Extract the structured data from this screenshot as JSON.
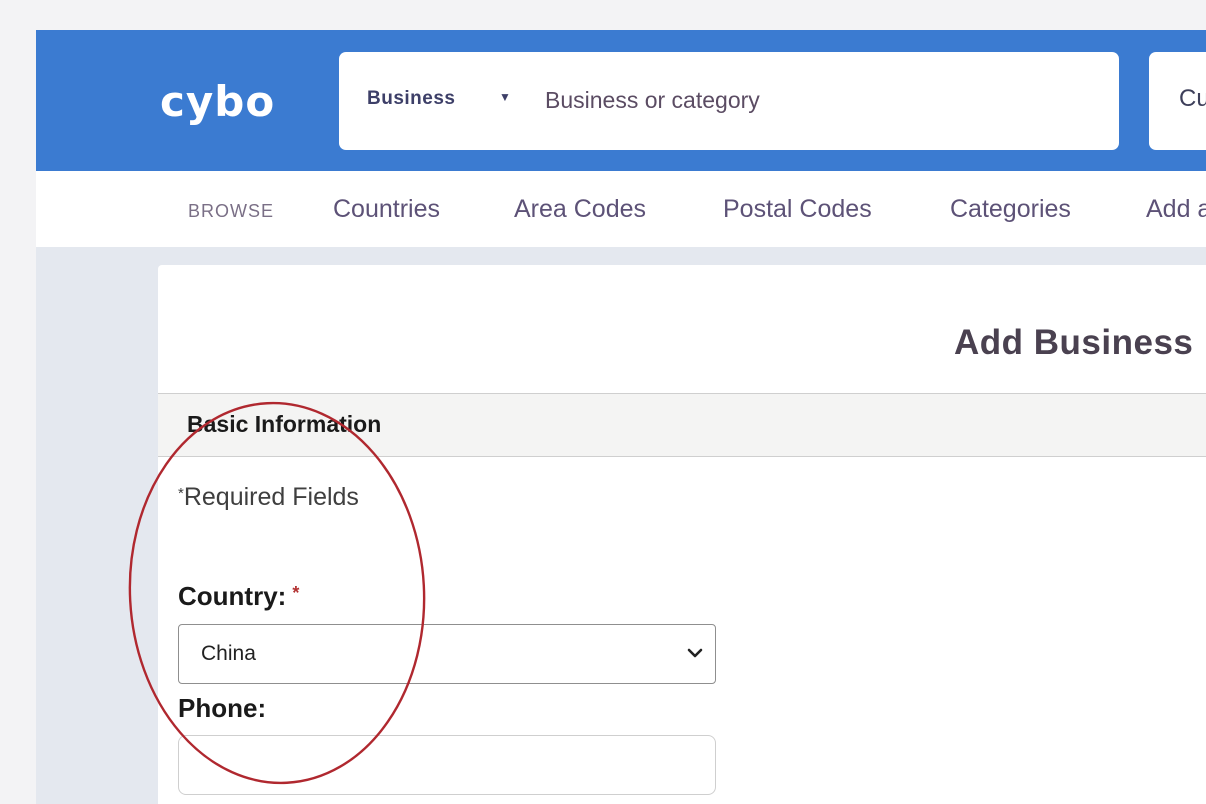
{
  "brand": {
    "logo_text": "cybo",
    "header_color": "#3b7bd1"
  },
  "search": {
    "type_label": "Business",
    "placeholder": "Business or category",
    "location_text": "Cu"
  },
  "nav": {
    "label": "BROWSE",
    "links": [
      "Countries",
      "Area Codes",
      "Postal Codes",
      "Categories",
      "Add a"
    ]
  },
  "form": {
    "title": "Add Business",
    "section_title": "Basic Information",
    "required_note": "Required Fields",
    "required_marker": "*",
    "country_label": "Country:",
    "country_value": "China",
    "phone_label": "Phone:",
    "phone_value": ""
  },
  "annotation": {
    "shape": "ellipse",
    "color": "#b0282f"
  },
  "icons": {
    "search_type_caret": "caret-down-icon",
    "select_chevron": "chevron-down-icon"
  }
}
